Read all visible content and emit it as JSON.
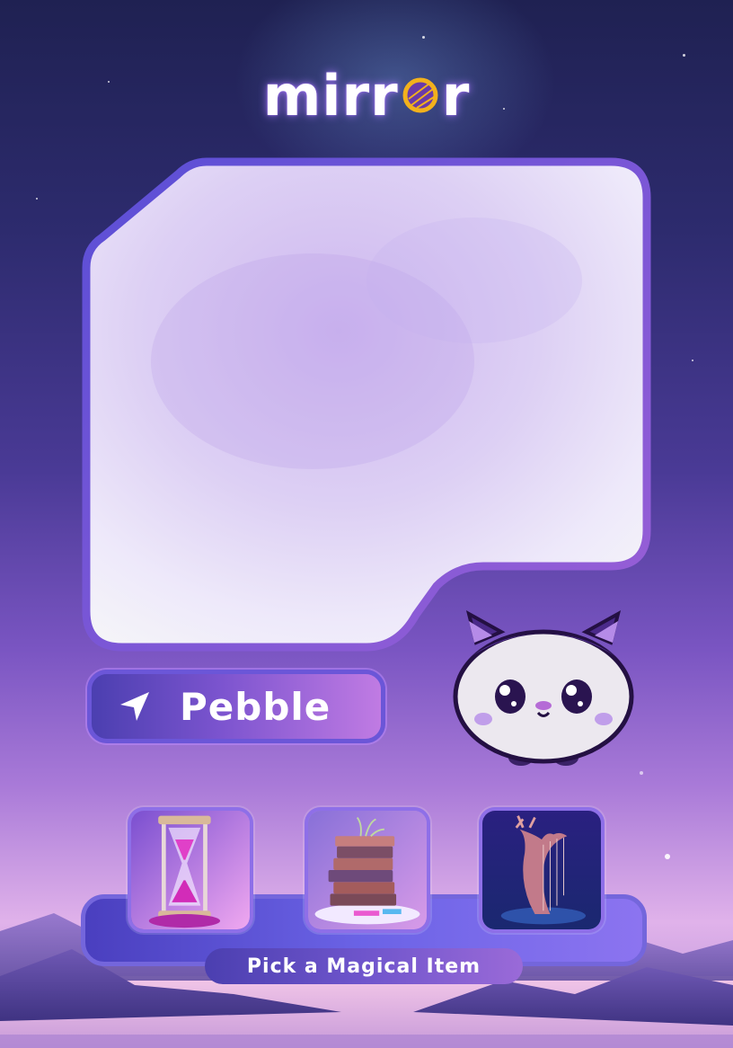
{
  "app": {
    "logo_text": "mirror",
    "logo_prefix": "mirr",
    "logo_suffix": "r"
  },
  "character": {
    "name": "Pebble"
  },
  "items": {
    "label": "Pick a Magical Item",
    "options": [
      {
        "icon": "hourglass-icon"
      },
      {
        "icon": "book-stack-icon"
      },
      {
        "icon": "harp-icon"
      }
    ]
  },
  "colors": {
    "accent": "#7c54cf",
    "frame_border": "#5b4fd0",
    "logo_ring": "#f2b11c",
    "tray": "#6b63e6"
  }
}
